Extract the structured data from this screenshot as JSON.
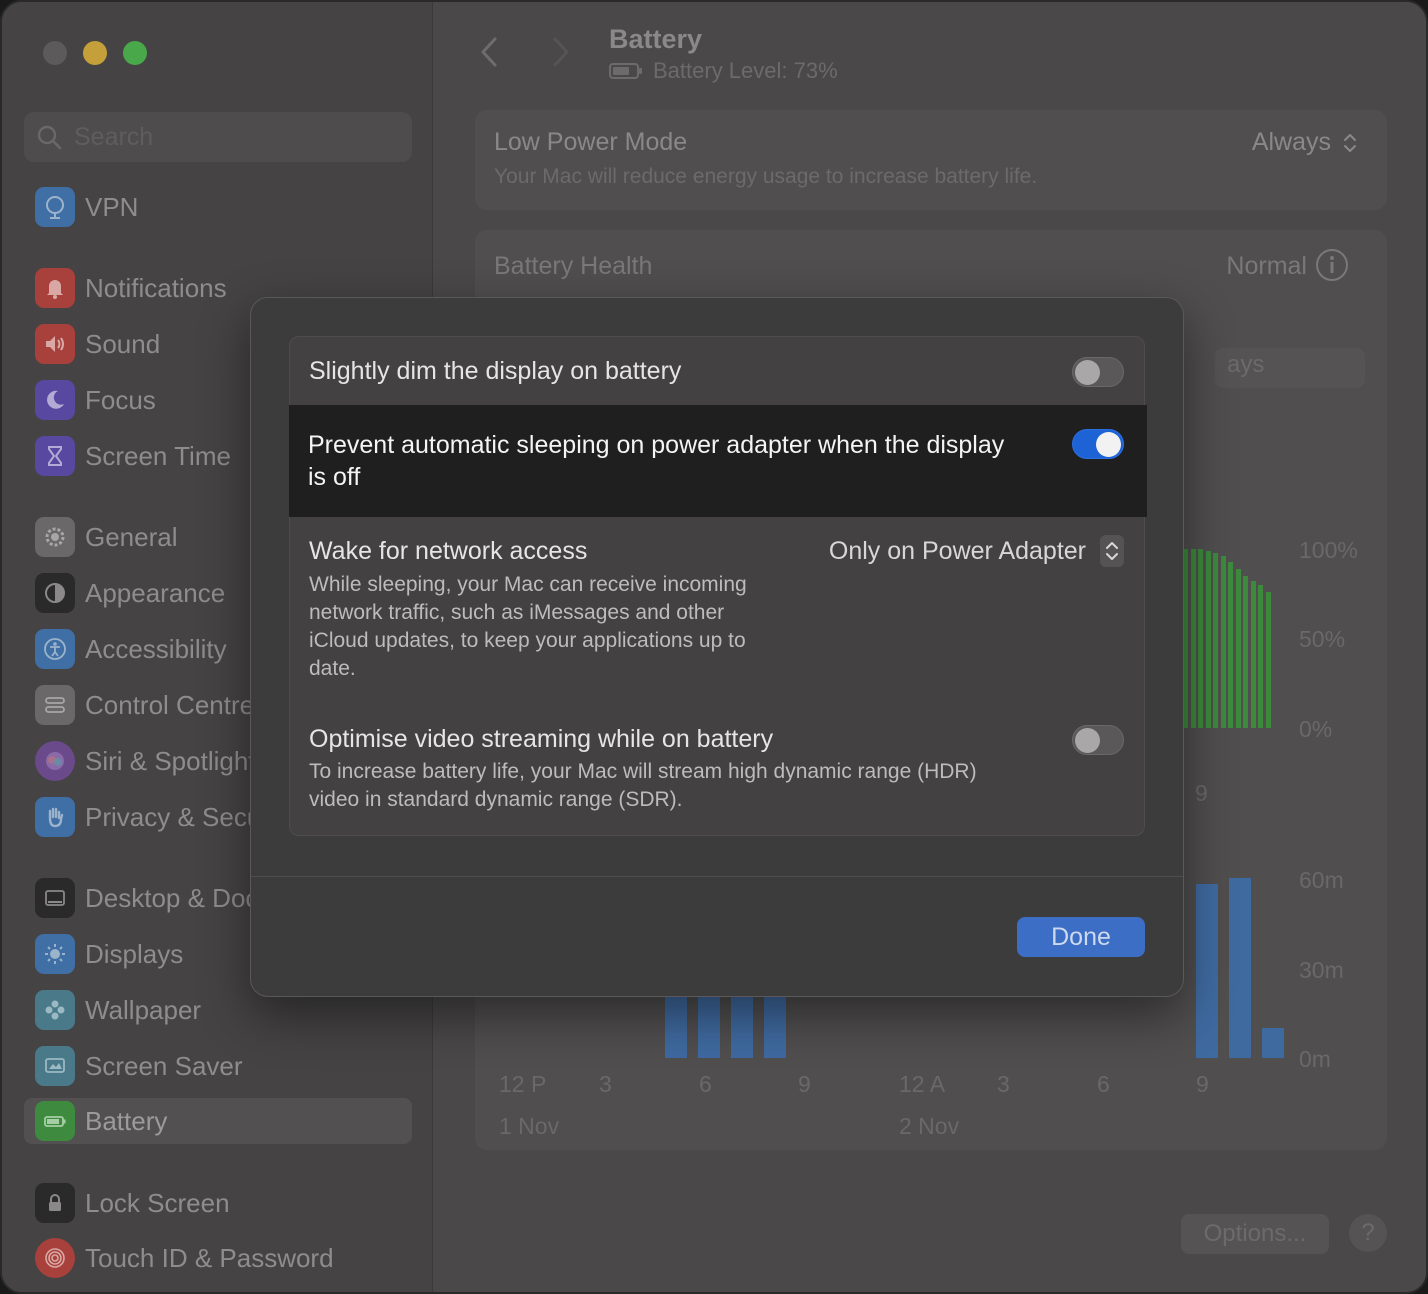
{
  "window": {
    "title": "Battery"
  },
  "search": {
    "placeholder": "Search"
  },
  "sidebar": {
    "items": [
      {
        "label": "VPN",
        "icon": "globe-icon",
        "color": "#3f6fa5"
      },
      {
        "label": "Notifications",
        "icon": "bell-icon",
        "color": "#a8403c"
      },
      {
        "label": "Sound",
        "icon": "speaker-icon",
        "color": "#a8403c"
      },
      {
        "label": "Focus",
        "icon": "moon-icon",
        "color": "#5848a0"
      },
      {
        "label": "Screen Time",
        "icon": "hourglass-icon",
        "color": "#5848a0"
      },
      {
        "label": "General",
        "icon": "gear-icon",
        "color": "#6a6868"
      },
      {
        "label": "Appearance",
        "icon": "appearance-icon",
        "color": "#2a2a2a"
      },
      {
        "label": "Accessibility",
        "icon": "accessibility-icon",
        "color": "#3f6fa5"
      },
      {
        "label": "Control Centre",
        "icon": "control-centre-icon",
        "color": "#6a6868"
      },
      {
        "label": "Siri & Spotlight",
        "icon": "siri-icon",
        "color": "#6a4a8a"
      },
      {
        "label": "Privacy & Security",
        "icon": "hand-icon",
        "color": "#3f6fa5"
      },
      {
        "label": "Desktop & Dock",
        "icon": "dock-icon",
        "color": "#2a2a2a"
      },
      {
        "label": "Displays",
        "icon": "sun-icon",
        "color": "#3f6fa5"
      },
      {
        "label": "Wallpaper",
        "icon": "flower-icon",
        "color": "#4a7a8a"
      },
      {
        "label": "Screen Saver",
        "icon": "screensaver-icon",
        "color": "#4a7a8a"
      },
      {
        "label": "Battery",
        "icon": "battery-icon",
        "color": "#3e8a3e"
      },
      {
        "label": "Lock Screen",
        "icon": "lock-icon",
        "color": "#2a2a2a"
      },
      {
        "label": "Touch ID & Password",
        "icon": "fingerprint-icon",
        "color": "#a8403c"
      }
    ]
  },
  "header": {
    "title": "Battery",
    "battery_level": "Battery Level: 73%"
  },
  "low_power": {
    "title": "Low Power Mode",
    "subtitle": "Your Mac will reduce energy usage to increase battery life.",
    "value": "Always"
  },
  "health": {
    "title": "Battery Health",
    "value": "Normal",
    "days_fragment": "ays"
  },
  "charts": {
    "level_axis": [
      "100%",
      "50%",
      "0%"
    ],
    "level_x_fragment": "9",
    "usage_axis": [
      "60m",
      "30m",
      "0m"
    ],
    "x_ticks_day1": [
      "12 P",
      "3",
      "6",
      "9"
    ],
    "x_ticks_day2": [
      "12 A",
      "3",
      "6",
      "9"
    ],
    "day1": "1 Nov",
    "day2": "2 Nov",
    "level_color": "#3d8a3d",
    "usage_color": "#3f6aa0"
  },
  "chart_data": [
    {
      "type": "bar",
      "title": "",
      "ylabel": "",
      "ylim": [
        0,
        100
      ],
      "y_tick_labels": [
        "100%",
        "50%",
        "0%"
      ],
      "categories": [
        "",
        "",
        "",
        "",
        "",
        "",
        "",
        "",
        "",
        "",
        "",
        ""
      ],
      "values": [
        100,
        100,
        100,
        99,
        98,
        96,
        93,
        89,
        85,
        82,
        80,
        76
      ]
    },
    {
      "type": "bar",
      "title": "",
      "ylabel": "",
      "ylim": [
        0,
        60
      ],
      "y_tick_labels": [
        "60m",
        "30m",
        "0m"
      ],
      "categories": [
        "",
        "",
        "",
        "",
        "",
        "",
        ""
      ],
      "values": [
        35,
        35,
        35,
        30,
        58,
        60,
        10
      ]
    }
  ],
  "footer": {
    "options_label": "Options...",
    "help_label": "?"
  },
  "modal": {
    "rows": [
      {
        "title": "Slightly dim the display on battery",
        "toggle": "off"
      },
      {
        "title": "Prevent automatic sleeping on power adapter when the display is off",
        "toggle": "on"
      },
      {
        "title": "Wake for network access",
        "value": "Only on Power Adapter",
        "description": "While sleeping, your Mac can receive incoming network traffic, such as iMessages and other iCloud updates, to keep your applications up to date."
      },
      {
        "title": "Optimise video streaming while on battery",
        "toggle": "off",
        "description": "To increase battery life, your Mac will stream high dynamic range (HDR) video in standard dynamic range (SDR)."
      }
    ],
    "done_label": "Done",
    "accent_color": "#1e63d6"
  }
}
